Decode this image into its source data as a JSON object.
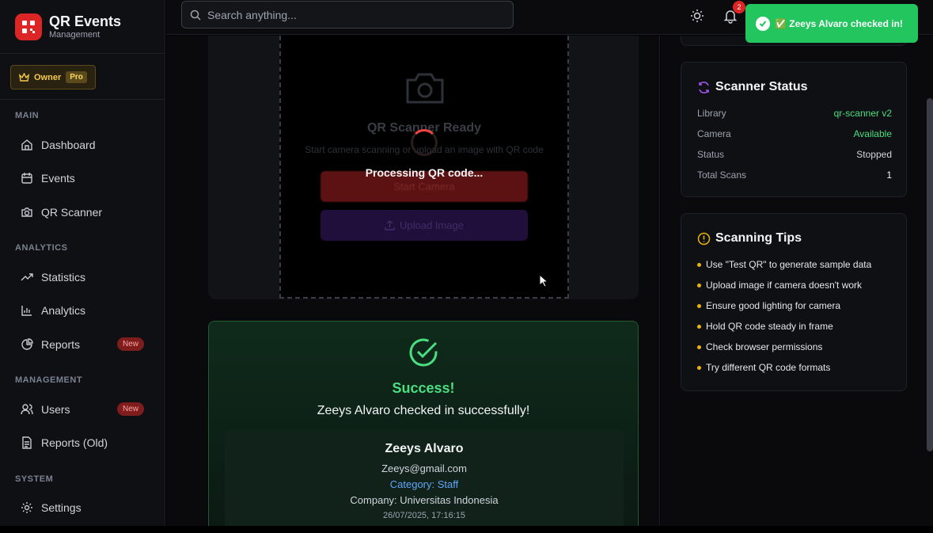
{
  "brand": {
    "title": "QR Events",
    "subtitle": "Management"
  },
  "role": {
    "label": "Owner",
    "tier": "Pro"
  },
  "sidebar": {
    "sections": [
      {
        "label": "MAIN"
      },
      {
        "label": "ANALYTICS"
      },
      {
        "label": "MANAGEMENT"
      },
      {
        "label": "SYSTEM"
      }
    ],
    "items": [
      {
        "label": "Dashboard",
        "icon": "home-icon"
      },
      {
        "label": "Events",
        "icon": "calendar-icon"
      },
      {
        "label": "QR Scanner",
        "icon": "camera-icon"
      },
      {
        "label": "Statistics",
        "icon": "trending-up-icon"
      },
      {
        "label": "Analytics",
        "icon": "bar-chart-icon"
      },
      {
        "label": "Reports",
        "icon": "pie-chart-icon",
        "badge": "New"
      },
      {
        "label": "Users",
        "icon": "users-icon",
        "badge": "New"
      },
      {
        "label": "Reports (Old)",
        "icon": "file-icon"
      },
      {
        "label": "Settings",
        "icon": "gear-icon"
      }
    ]
  },
  "topbar": {
    "search_placeholder": "Search anything...",
    "notification_count": "2"
  },
  "scanner": {
    "ready_title": "QR Scanner Ready",
    "ready_subtitle": "Start camera scanning or upload an image with QR code",
    "processing": "Processing QR code...",
    "start_label": "Start Camera",
    "upload_label": "Upload Image"
  },
  "success": {
    "title": "Success!",
    "message": "Zeeys Alvaro checked in successfully!",
    "name": "Zeeys Alvaro",
    "email": "Zeeys@gmail.com",
    "category": "Category: Staff",
    "company": "Company: Universitas Indonesia",
    "timestamp": "26/07/2025, 17:16:15"
  },
  "status_panel": {
    "title": "Scanner Status",
    "rows": [
      {
        "label": "Library",
        "value": "qr-scanner v2",
        "color": "#4ade80"
      },
      {
        "label": "Camera",
        "value": "Available",
        "color": "#4ade80"
      },
      {
        "label": "Status",
        "value": "Stopped",
        "color": "#d1d5db"
      },
      {
        "label": "Total Scans",
        "value": "1",
        "color": "#f3f4f6"
      }
    ]
  },
  "tips_panel": {
    "title": "Scanning Tips",
    "tips": [
      "Use \"Test QR\" to generate sample data",
      "Upload image if camera doesn't work",
      "Ensure good lighting for camera",
      "Hold QR code steady in frame",
      "Check browser permissions",
      "Try different QR code formats"
    ]
  },
  "toast": {
    "message": "✅ Zeeys Alvaro checked in!"
  },
  "colors": {
    "accent": "#dc2626",
    "success": "#22c55e",
    "link": "#60a5fa",
    "warning": "#eab308"
  }
}
